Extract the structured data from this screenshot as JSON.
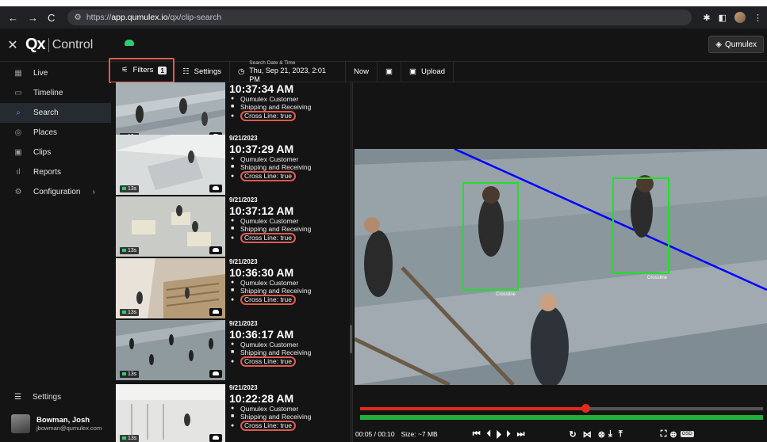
{
  "browser": {
    "url_prefix": "https://",
    "url_host": "app.qumulex.io",
    "url_path": "/qx/clip-search"
  },
  "app": {
    "logo": "Qx",
    "product": "Control",
    "org_button": "Qumulex"
  },
  "sidebar": {
    "items": [
      {
        "label": "Live",
        "icon": "grid-icon"
      },
      {
        "label": "Timeline",
        "icon": "timeline-icon"
      },
      {
        "label": "Search",
        "icon": "search-icon"
      },
      {
        "label": "Places",
        "icon": "location-icon"
      },
      {
        "label": "Clips",
        "icon": "clips-icon"
      },
      {
        "label": "Reports",
        "icon": "reports-icon"
      },
      {
        "label": "Configuration",
        "icon": "gear-icon"
      }
    ],
    "settings_label": "Settings",
    "user_name": "Bowman, Josh",
    "user_email": "jbowman@qumulex.com"
  },
  "toolbar": {
    "filters_label": "Filters",
    "filters_count": "1",
    "settings_label": "Settings",
    "date_label": "Search Date & Time",
    "date_value": "Thu, Sep 21, 2023, 2:01 PM",
    "now_label": "Now",
    "upload_label": "Upload"
  },
  "clips": [
    {
      "date": "",
      "time": "10:37:34 AM",
      "site": "Qumulex Customer",
      "camera": "Shipping and Receiving",
      "event": "Cross Line: true",
      "duration": "13s"
    },
    {
      "date": "9/21/2023",
      "time": "10:37:29 AM",
      "site": "Qumulex Customer",
      "camera": "Shipping and Receiving",
      "event": "Cross Line: true",
      "duration": "13s"
    },
    {
      "date": "9/21/2023",
      "time": "10:37:12 AM",
      "site": "Qumulex Customer",
      "camera": "Shipping and Receiving",
      "event": "Cross Line: true",
      "duration": "13s"
    },
    {
      "date": "9/21/2023",
      "time": "10:36:30 AM",
      "site": "Qumulex Customer",
      "camera": "Shipping and Receiving",
      "event": "Cross Line: true",
      "duration": "13s"
    },
    {
      "date": "9/21/2023",
      "time": "10:36:17 AM",
      "site": "Qumulex Customer",
      "camera": "Shipping and Receiving",
      "event": "Cross Line: true",
      "duration": "13s"
    },
    {
      "date": "9/21/2023",
      "time": "10:22:28 AM",
      "site": "Qumulex Customer",
      "camera": "Shipping and Receiving",
      "event": "Cross Line: true",
      "duration": "13s"
    }
  ],
  "player": {
    "detection_label": "Crossline",
    "time": "00:05 / 00:10",
    "size": "Size: ~7 MB",
    "progress_fraction": 0.56,
    "osd_label": "OSD"
  },
  "colors": {
    "accent_blue": "#4aa3ff",
    "highlight_red": "#e05a4f",
    "detection_green": "#1fe028",
    "crossline_blue": "#0000ff"
  }
}
